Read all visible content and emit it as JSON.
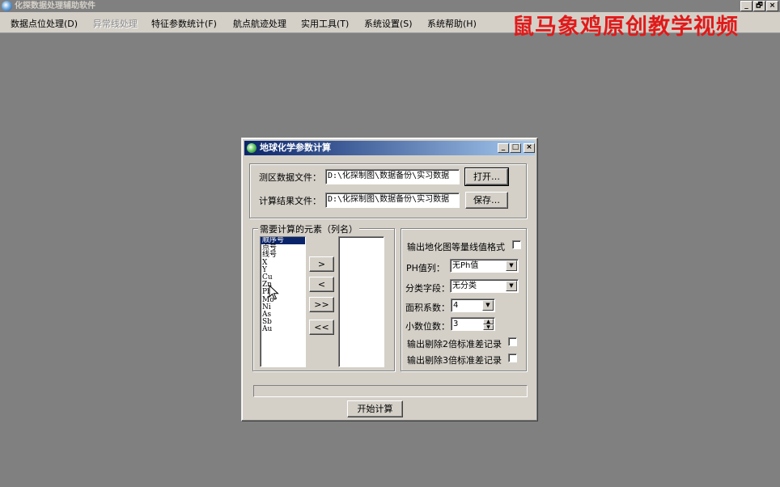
{
  "window": {
    "title": "化探数据处理辅助软件",
    "icon": "globe-icon",
    "controls": [
      "_",
      "🗗",
      "×"
    ]
  },
  "menu": [
    {
      "label": "数据点位处理(D)",
      "enabled": true
    },
    {
      "label": "异常线处理",
      "enabled": false
    },
    {
      "label": "特征参数统计(F)",
      "enabled": true
    },
    {
      "label": "航点航迹处理",
      "enabled": true
    },
    {
      "label": "实用工具(T)",
      "enabled": true
    },
    {
      "label": "系统设置(S)",
      "enabled": true
    },
    {
      "label": "系统帮助(H)",
      "enabled": true
    }
  ],
  "watermark": "鼠马象鸡原创教学视频",
  "dialog": {
    "title": "地球化学参数计算",
    "icon": "globe-icon",
    "controls": [
      "_",
      "□",
      "×"
    ],
    "files": {
      "survey_label": "测区数据文件：",
      "survey_value": "D:\\化探制图\\数据备份\\实习数据",
      "open_button": "打开…",
      "result_label": "计算结果文件：",
      "result_value": "D:\\化探制图\\数据备份\\实习数据",
      "save_button": "保存…"
    },
    "elements": {
      "group_title": "需要计算的元素（列名）",
      "source_list": [
        "顺序号",
        "点号",
        "线号",
        "X",
        "Y",
        "Cu",
        "Zn",
        "Pb",
        "Mo",
        "Ni",
        "As",
        "Sb",
        "Au"
      ],
      "selected_index": 0,
      "target_list": [],
      "buttons": {
        "add": ">",
        "remove": "<",
        "add_all": ">>",
        "remove_all": "<<"
      }
    },
    "options": {
      "contour_format_label": "输出地化图等量线值格式",
      "contour_format_checked": false,
      "ph_label": "PH值列：",
      "ph_value": "无Ph值",
      "category_label": "分类字段：",
      "category_value": "无分类",
      "area_label": "面积系数：",
      "area_value": "4",
      "decimal_label": "小数位数：",
      "decimal_value": "3",
      "exclude2_label": "输出剔除2倍标准差记录",
      "exclude2_checked": false,
      "exclude3_label": "输出剔除3倍标准差记录",
      "exclude3_checked": false
    },
    "progress": 0,
    "start_button": "开始计算"
  }
}
